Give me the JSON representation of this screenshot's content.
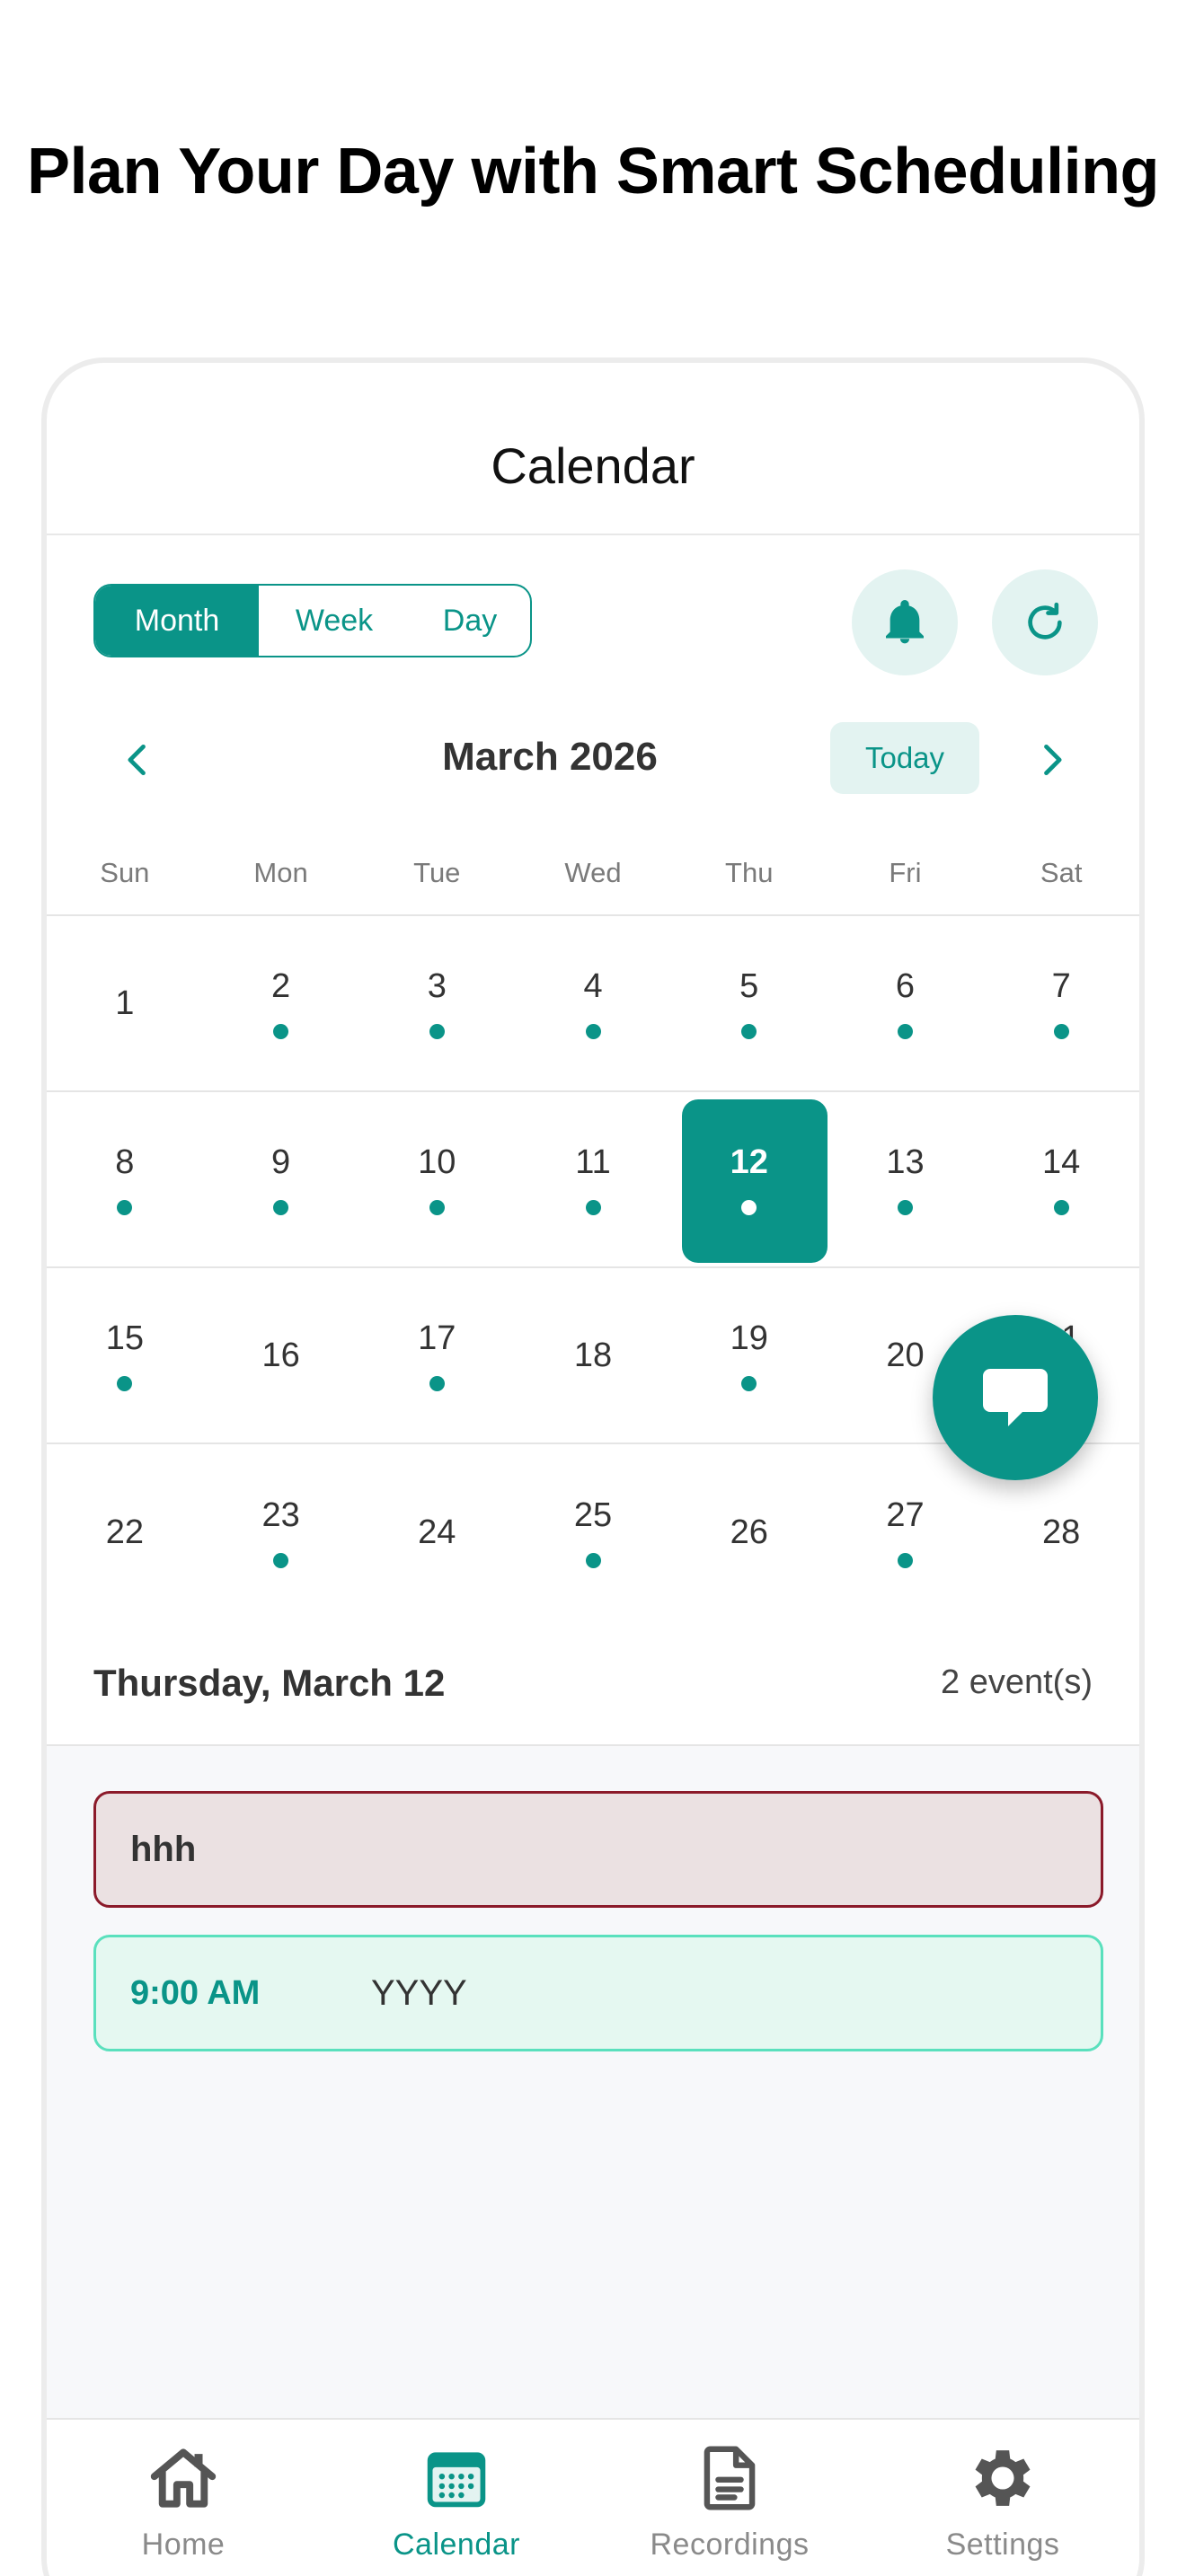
{
  "headline": "Plan Your Day with Smart Scheduling",
  "screen_title": "Calendar",
  "view_modes": {
    "month": "Month",
    "week": "Week",
    "day": "Day",
    "active": "Month"
  },
  "nav": {
    "month_label": "March 2026",
    "today": "Today"
  },
  "weekdays": [
    "Sun",
    "Mon",
    "Tue",
    "Wed",
    "Thu",
    "Fri",
    "Sat"
  ],
  "weeks": [
    [
      {
        "d": "1",
        "dot": false
      },
      {
        "d": "2",
        "dot": true
      },
      {
        "d": "3",
        "dot": true
      },
      {
        "d": "4",
        "dot": true
      },
      {
        "d": "5",
        "dot": true
      },
      {
        "d": "6",
        "dot": true
      },
      {
        "d": "7",
        "dot": true
      }
    ],
    [
      {
        "d": "8",
        "dot": true
      },
      {
        "d": "9",
        "dot": true
      },
      {
        "d": "10",
        "dot": true
      },
      {
        "d": "11",
        "dot": true
      },
      {
        "d": "12",
        "dot": true,
        "selected": true
      },
      {
        "d": "13",
        "dot": true
      },
      {
        "d": "14",
        "dot": true
      }
    ],
    [
      {
        "d": "15",
        "dot": true
      },
      {
        "d": "16",
        "dot": false
      },
      {
        "d": "17",
        "dot": true
      },
      {
        "d": "18",
        "dot": false
      },
      {
        "d": "19",
        "dot": true
      },
      {
        "d": "20",
        "dot": false
      },
      {
        "d": "21",
        "dot": true
      }
    ],
    [
      {
        "d": "22",
        "dot": false
      },
      {
        "d": "23",
        "dot": true
      },
      {
        "d": "24",
        "dot": false
      },
      {
        "d": "25",
        "dot": true
      },
      {
        "d": "26",
        "dot": false
      },
      {
        "d": "27",
        "dot": true
      },
      {
        "d": "28",
        "dot": false
      }
    ]
  ],
  "selected_day": {
    "label": "Thursday, March 12",
    "count": "2 event(s)"
  },
  "events": [
    {
      "time": "",
      "title": "hhh"
    },
    {
      "time": "9:00 AM",
      "title": "YYYY"
    }
  ],
  "tabs": {
    "home": "Home",
    "calendar": "Calendar",
    "recordings": "Recordings",
    "settings": "Settings",
    "active": "Calendar"
  },
  "icons": {
    "bell": "bell-icon",
    "refresh": "refresh-icon",
    "prev": "chevron-left-icon",
    "next": "chevron-right-icon",
    "fab": "chat-bubble-icon",
    "home": "home-icon",
    "calendar": "calendar-icon",
    "recordings": "document-icon",
    "settings": "gear-icon"
  },
  "colors": {
    "accent": "#0a9488",
    "accent_light": "#e3f3f1",
    "event_red_border": "#8b1a2a",
    "event_green_border": "#5ae0bd"
  }
}
